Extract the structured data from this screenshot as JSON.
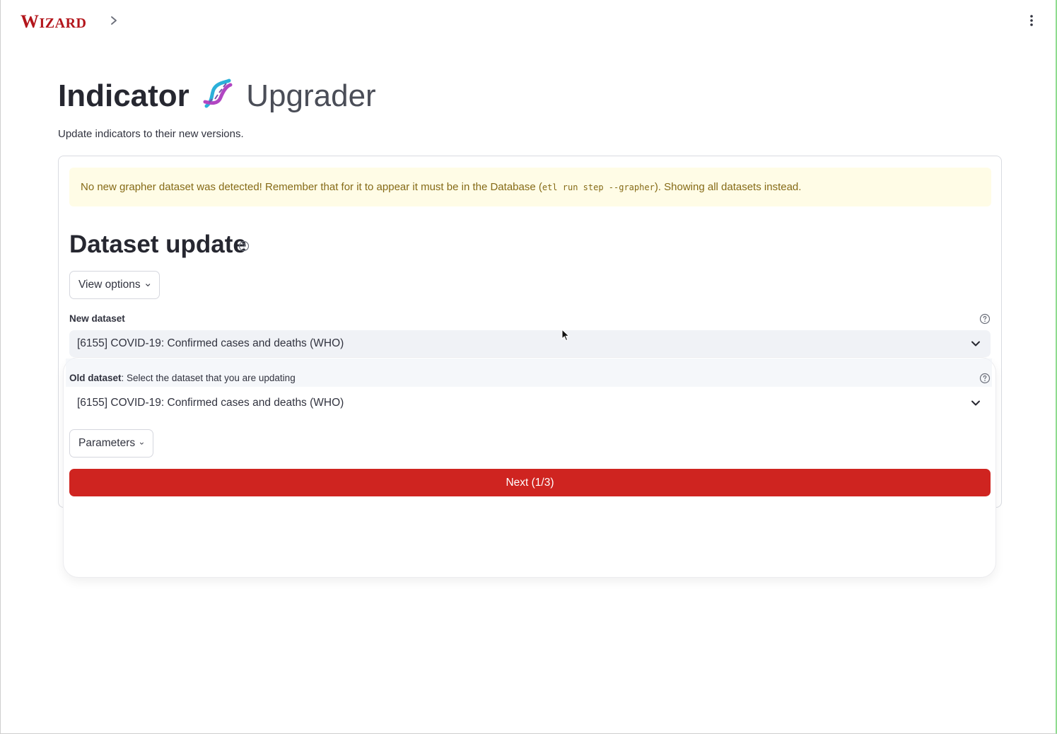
{
  "app": {
    "logo_first": "W",
    "logo_rest": "IZARD"
  },
  "header": {
    "title_main": "Indicator",
    "title_accent": "Upgrader",
    "title_icon": "dna-icon",
    "subtitle": "Update indicators to their new versions."
  },
  "warning": {
    "text_before": "No new grapher dataset was detected! Remember that for it to appear it must be in the Database (",
    "code": "etl run step --grapher",
    "text_after": "). Showing all datasets instead."
  },
  "section": {
    "title": "Dataset update",
    "help_icon": "question-circle-icon"
  },
  "view_options": {
    "label": "View options"
  },
  "new_dataset": {
    "label": "New dataset",
    "value": "[6155] COVID-19: Confirmed cases and deaths (WHO)"
  },
  "old_dataset": {
    "label_bold": "Old dataset",
    "label_rest": ": Select the dataset that you are updating",
    "value": "[6155] COVID-19: Confirmed cases and deaths (WHO)"
  },
  "parameters": {
    "label": "Parameters"
  },
  "next_button": {
    "label": "Next (1/3)"
  },
  "colors": {
    "brand_red": "#b3151b",
    "primary_button": "#cf2420",
    "warning_bg": "#fffce6",
    "warning_text": "#856a16",
    "select_bg": "#f0f2f6"
  }
}
